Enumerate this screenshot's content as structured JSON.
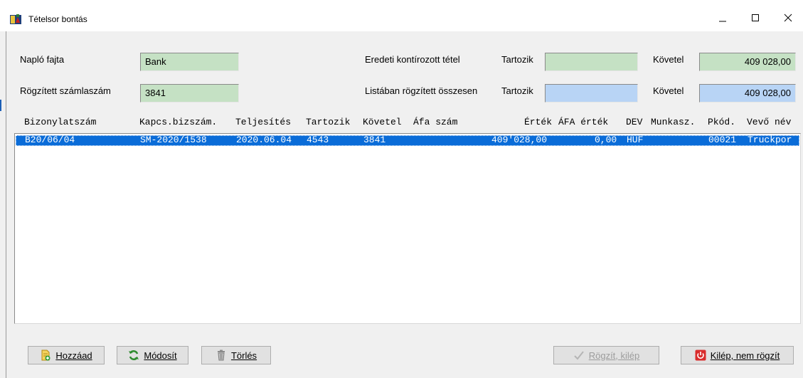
{
  "window": {
    "title": "Tételsor bontás",
    "icon": "ledger-app-icon",
    "controls": [
      "minimize-icon",
      "maximize-icon",
      "close-icon"
    ]
  },
  "form": {
    "naplo_label": "Napló fajta",
    "naplo_value": "Bank",
    "rogzitett_label": "Rögzített számlaszám",
    "rogzitett_value": "3841",
    "eredeti_label": "Eredeti kontírozott tétel",
    "eredeti_tartozik_label": "Tartozik",
    "eredeti_tartozik_value": "",
    "eredeti_kovetel_label": "Követel",
    "eredeti_kovetel_value": "409 028,00",
    "lista_label": "Listában rögzített összesen",
    "lista_tartozik_label": "Tartozik",
    "lista_tartozik_value": "",
    "lista_kovetel_label": "Követel",
    "lista_kovetel_value": "409 028,00"
  },
  "table": {
    "columns": [
      "Bizonylatszám",
      "Kapcs.bizszám.",
      "Teljesítés",
      "Tartozik",
      "Követel",
      "Áfa szám",
      "Érték",
      "ÁFA érték",
      "DEV",
      "Munkasz.",
      "Pkód.",
      "Vevő név"
    ],
    "rows": [
      {
        "bizonylatszam": "B20/06/04",
        "kapcs": "SM-2020/1538",
        "teljesites": "2020.06.04",
        "tartozik": "4543",
        "kovetel": "3841",
        "afa_szam": "",
        "ertek": "409'028,00",
        "afa_ertek": "0,00",
        "dev": "HUF",
        "munkasz": "",
        "pkod": "00021",
        "vevo_nev": "Truckpor"
      }
    ],
    "selected_row": 0
  },
  "buttons": {
    "add": {
      "label": "Hozzáad",
      "icon": "add-document-icon"
    },
    "modify": {
      "label": "Módosít",
      "icon": "refresh-icon"
    },
    "delete": {
      "label": "Törlés",
      "icon": "trash-icon"
    },
    "save_exit": {
      "label": "Rögzít, kilép",
      "icon": "checkmark-icon",
      "disabled": true
    },
    "exit_no_save": {
      "label": "Kilép, nem rögzít",
      "icon": "power-icon"
    }
  },
  "colors": {
    "field_green": "#c5e1c4",
    "field_blue": "#b8d4f5",
    "selection": "#0a6cd8"
  }
}
